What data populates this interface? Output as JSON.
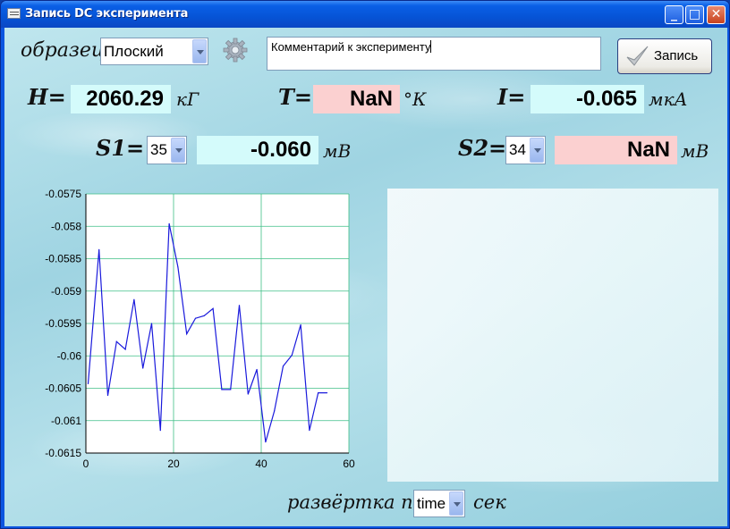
{
  "window": {
    "title": "Запись DC эксперимента",
    "controls": {
      "minimize": "_",
      "maximize": "□",
      "close": "✕"
    }
  },
  "sample": {
    "label": "образец",
    "selected": "Плоский"
  },
  "comment": {
    "value": "Комментарий к эксперименту"
  },
  "record_button": {
    "label": "Запись",
    "icon": "checkmark-icon"
  },
  "readings": {
    "H": {
      "label": "H=",
      "value": "2060.29",
      "unit": "кГ"
    },
    "T": {
      "label": "T=",
      "value": "NaN",
      "unit": "°К"
    },
    "I": {
      "label": "I=",
      "value": "-0.065",
      "unit": "мкА"
    },
    "S1": {
      "label": "S1=",
      "channel": "35",
      "value": "-0.060",
      "unit": "мВ"
    },
    "S2": {
      "label": "S2=",
      "channel": "34",
      "value": "NaN",
      "unit": "мВ"
    }
  },
  "sweep": {
    "label": "развёртка по",
    "selected": "time",
    "unit": "сек"
  },
  "colors": {
    "value_cyan": "#d4fbfb",
    "value_pink": "#fbd0d0",
    "plot_line": "#1a1adc",
    "grid": "#3fbf86"
  },
  "chart_data": {
    "type": "line",
    "xlim": [
      0,
      60
    ],
    "ylim": [
      -0.0615,
      -0.0575
    ],
    "x_ticks": [
      "0",
      "20",
      "40",
      "60"
    ],
    "y_ticks": [
      "-0.0575",
      "-0.058",
      "-0.0585",
      "-0.059",
      "-0.0595",
      "-0.06",
      "-0.0605",
      "-0.061",
      "-0.0615"
    ],
    "grid": true,
    "series": [
      {
        "x": [
          0.5,
          3,
          5,
          7,
          9,
          11,
          13,
          15,
          17,
          19,
          21,
          23,
          25,
          27,
          29,
          31,
          33,
          35,
          37,
          39,
          41,
          43,
          45,
          47,
          49,
          51,
          53,
          55
        ],
        "y": [
          -0.06043,
          -0.05836,
          -0.06061,
          -0.05978,
          -0.0599,
          -0.05913,
          -0.06019,
          -0.0595,
          -0.06115,
          -0.05796,
          -0.05863,
          -0.05966,
          -0.05942,
          -0.05938,
          -0.05927,
          -0.06052,
          -0.06052,
          -0.05922,
          -0.06059,
          -0.06021,
          -0.06133,
          -0.06085,
          -0.06016,
          -0.05999,
          -0.05952,
          -0.06115,
          -0.06057,
          -0.06057
        ]
      }
    ]
  }
}
